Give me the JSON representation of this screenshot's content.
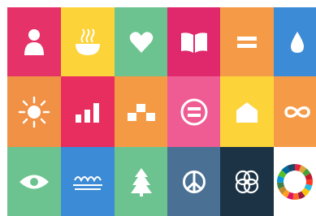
{
  "tiles": [
    {
      "id": "goal-1",
      "icon": "person-icon",
      "color": "#E5243B"
    },
    {
      "id": "goal-2",
      "icon": "bowl-icon",
      "color": "#DDA63A"
    },
    {
      "id": "goal-3",
      "icon": "heart-icon",
      "color": "#4C9F38"
    },
    {
      "id": "goal-4",
      "icon": "book-icon",
      "color": "#C5192D"
    },
    {
      "id": "goal-5",
      "icon": "equals-icon",
      "color": "#FF3A21"
    },
    {
      "id": "goal-6",
      "icon": "water-drop-icon",
      "color": "#26BDE2"
    },
    {
      "id": "goal-7",
      "icon": "sun-icon",
      "color": "#FCC30B"
    },
    {
      "id": "goal-8",
      "icon": "bar-chart-icon",
      "color": "#A21942"
    },
    {
      "id": "goal-9",
      "icon": "blocks-icon",
      "color": "#FD6925"
    },
    {
      "id": "goal-10",
      "icon": "equals-circle-icon",
      "color": "#DD1367"
    },
    {
      "id": "goal-11",
      "icon": "house-icon",
      "color": "#FD9D24"
    },
    {
      "id": "goal-12",
      "icon": "infinity-icon",
      "color": "#BF8B2E"
    },
    {
      "id": "goal-13",
      "icon": "eye-icon",
      "color": "#3F7E44"
    },
    {
      "id": "goal-14",
      "icon": "waves-icon",
      "color": "#0A97D9"
    },
    {
      "id": "goal-15",
      "icon": "tree-icon",
      "color": "#56C02B"
    },
    {
      "id": "goal-16",
      "icon": "peace-icon",
      "color": "#00689D"
    },
    {
      "id": "goal-17",
      "icon": "rings-icon",
      "color": "#19486A"
    },
    {
      "id": "sdg-wheel",
      "icon": "sdg-wheel-icon",
      "color": "#FFFFFF"
    }
  ],
  "display_colors": {
    "r0": [
      "#E5336A",
      "#FDD33A",
      "#6CC38F",
      "#E0296D",
      "#F59A47",
      "#3C8BD6"
    ],
    "r1": [
      "#F09146",
      "#E72E5E",
      "#F49A45",
      "#EF5C93",
      "#FDD33A",
      "#F59A47"
    ],
    "r2": [
      "#6CC38F",
      "#3C8BD6",
      "#6CC38F",
      "#4A7093",
      "#1C3346",
      "#FFFFFF"
    ]
  }
}
